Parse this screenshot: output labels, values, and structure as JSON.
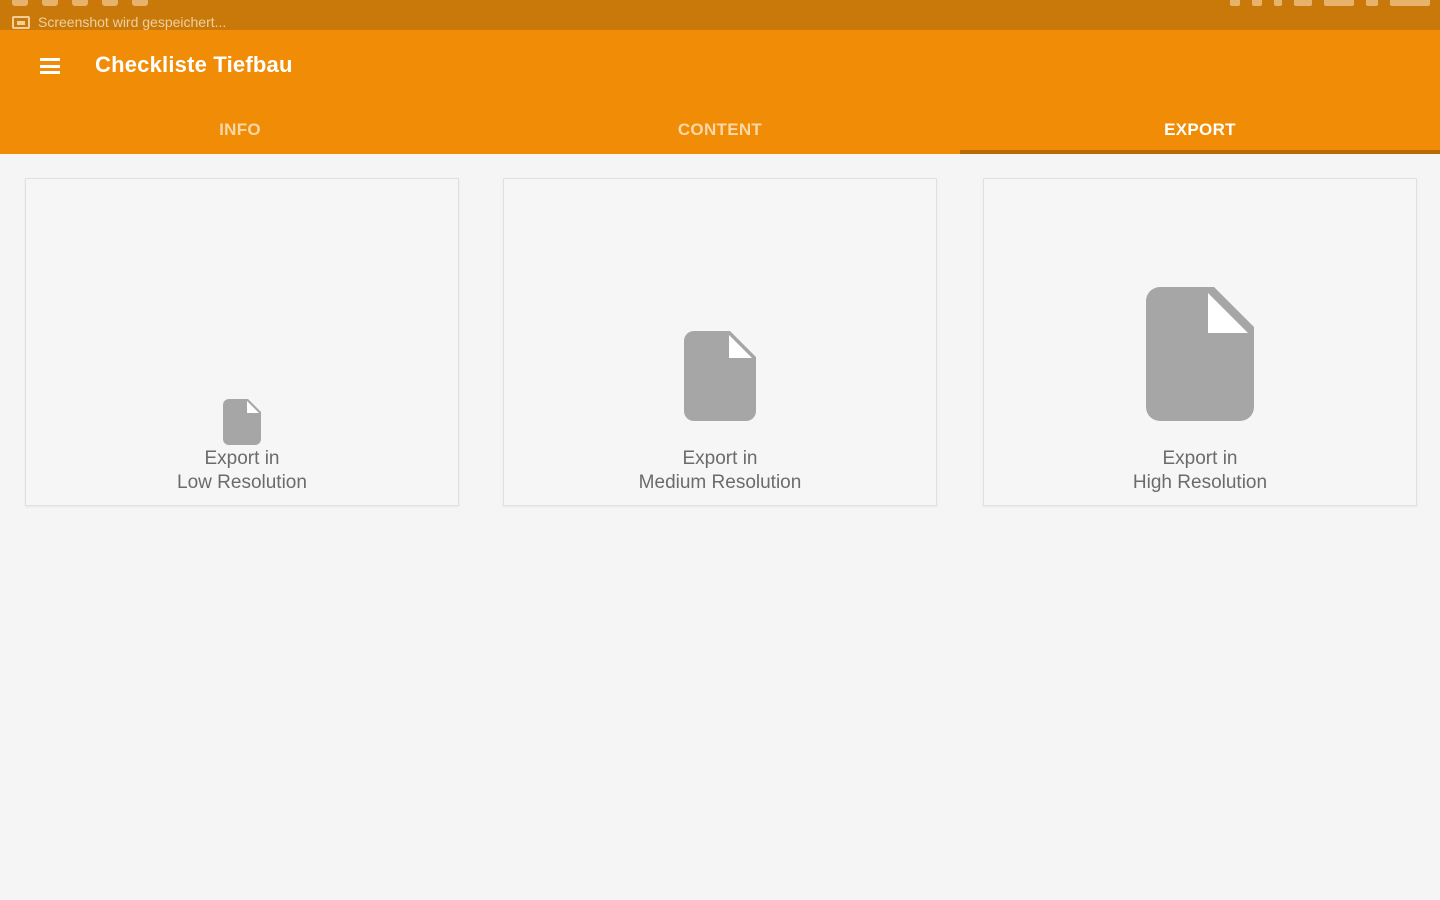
{
  "status_bar": {
    "notification": "Screenshot wird gespeichert..."
  },
  "app_bar": {
    "title": "Checkliste Tiefbau",
    "menu_icon": "menu-icon"
  },
  "tabs": [
    {
      "label": "INFO",
      "active": false
    },
    {
      "label": "CONTENT",
      "active": false
    },
    {
      "label": "EXPORT",
      "active": true
    }
  ],
  "export_options": [
    {
      "line1": "Export in",
      "line2": "Low Resolution",
      "icon": "document-icon"
    },
    {
      "line1": "Export in",
      "line2": "Medium Resolution",
      "icon": "document-icon"
    },
    {
      "line1": "Export in",
      "line2": "High Resolution",
      "icon": "document-icon"
    }
  ],
  "colors": {
    "primary": "#f08c05",
    "status_bar": "#c9790a",
    "tab_indicator": "#b86a04",
    "icon_gray": "#a6a6a6",
    "text_gray": "#6b6b6b",
    "background": "#f5f5f5"
  }
}
